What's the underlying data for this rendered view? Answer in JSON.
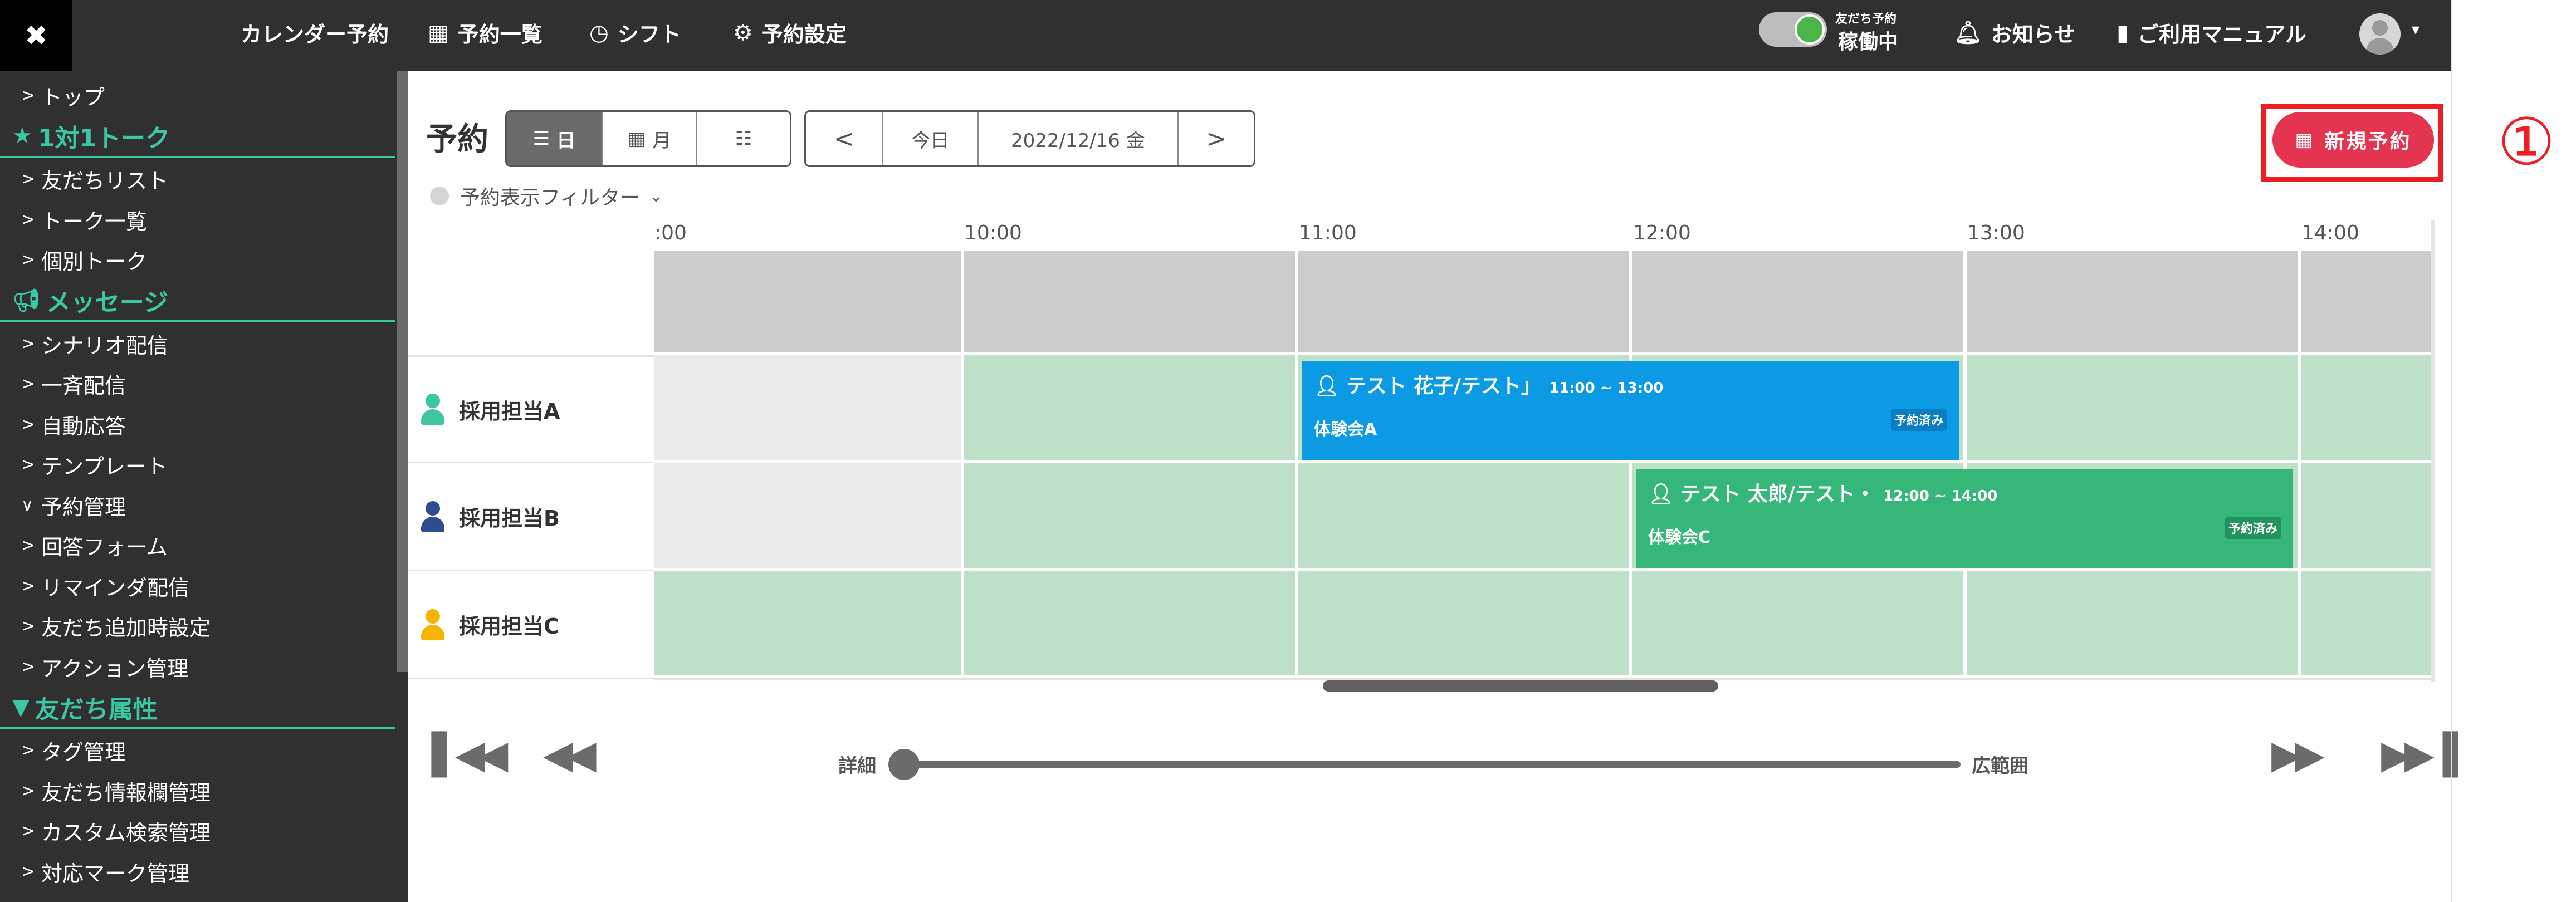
{
  "topbar": {
    "close": "✖",
    "nav": [
      {
        "label": "カレンダー予約",
        "icon": ""
      },
      {
        "label": "予約一覧",
        "icon": "calendar-grid-icon"
      },
      {
        "label": "シフト",
        "icon": "clock-icon"
      },
      {
        "label": "予約設定",
        "icon": "gear-icon"
      }
    ],
    "status_small": "友だち予約",
    "status_main": "稼働中",
    "notifications": "お知らせ",
    "manual": "ご利用マニュアル"
  },
  "sidebar": {
    "items": [
      {
        "type": "item",
        "label": "トップ",
        "chev": ">"
      },
      {
        "type": "header",
        "label": "1対1トーク",
        "icon": "star-icon"
      },
      {
        "type": "item",
        "label": "友だちリスト",
        "chev": ">"
      },
      {
        "type": "item",
        "label": "トーク一覧",
        "chev": ">"
      },
      {
        "type": "item",
        "label": "個別トーク",
        "chev": ">"
      },
      {
        "type": "header",
        "label": "メッセージ",
        "icon": "megaphone-icon"
      },
      {
        "type": "item",
        "label": "シナリオ配信",
        "chev": ">"
      },
      {
        "type": "item",
        "label": "一斉配信",
        "chev": ">"
      },
      {
        "type": "item",
        "label": "自動応答",
        "chev": ">"
      },
      {
        "type": "item",
        "label": "テンプレート",
        "chev": ">"
      },
      {
        "type": "item",
        "label": "予約管理",
        "chev": "∨"
      },
      {
        "type": "item",
        "label": "回答フォーム",
        "chev": ">"
      },
      {
        "type": "item",
        "label": "リマインダ配信",
        "chev": ">"
      },
      {
        "type": "item",
        "label": "友だち追加時設定",
        "chev": ">"
      },
      {
        "type": "item",
        "label": "アクション管理",
        "chev": ">"
      },
      {
        "type": "header",
        "label": "友だち属性",
        "icon": "filter-icon"
      },
      {
        "type": "item",
        "label": "タグ管理",
        "chev": ">"
      },
      {
        "type": "item",
        "label": "友だち情報欄管理",
        "chev": ">"
      },
      {
        "type": "item",
        "label": "カスタム検索管理",
        "chev": ">"
      },
      {
        "type": "item",
        "label": "対応マーク管理",
        "chev": ">"
      }
    ]
  },
  "main": {
    "title": "予約",
    "view_day": "日",
    "view_month": "月",
    "prev": "<",
    "today": "今日",
    "date": "2022/12/16 金",
    "next": ">",
    "new_button": "新規予約",
    "annotation": "①",
    "filter": "予約表示フィルター"
  },
  "timeline": {
    "hours": [
      ":00",
      "10:00",
      "11:00",
      "12:00",
      "13:00",
      "14:00"
    ],
    "resources": [
      {
        "name": "採用担当A",
        "icon_color": "#3cc7a0"
      },
      {
        "name": "採用担当B",
        "icon_color": "#2c4e91"
      },
      {
        "name": "採用担当C",
        "icon_color": "#f4b400"
      }
    ],
    "events": [
      {
        "title": "テスト 花子/テスト」",
        "time": "11:00 ~ 13:00",
        "sub": "体験会A",
        "badge": "予約済み",
        "color": "#0d9ae4",
        "badge_bg": "#0a7ec0"
      },
      {
        "title": "テスト 太郎/テスト・",
        "time": "12:00 ~ 14:00",
        "sub": "体験会C",
        "badge": "予約済み",
        "color": "#35b77a",
        "badge_bg": "#25935e"
      }
    ]
  },
  "zoom": {
    "detail": "詳細",
    "wide": "広範囲"
  }
}
